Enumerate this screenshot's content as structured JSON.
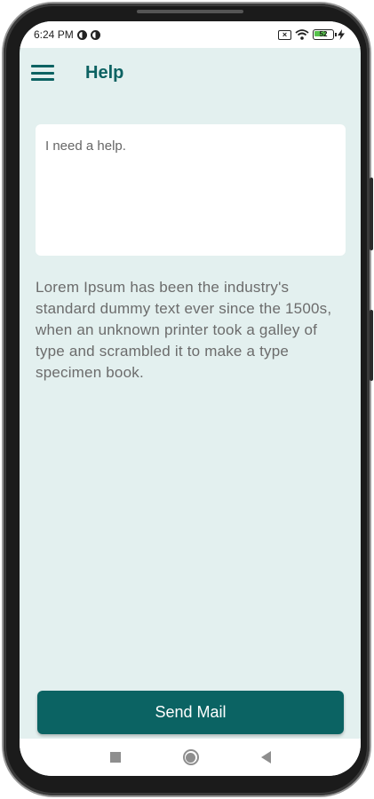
{
  "status_bar": {
    "time": "6:24 PM",
    "battery_level": "52"
  },
  "app_bar": {
    "title": "Help"
  },
  "message": {
    "placeholder": "I need a help."
  },
  "help": {
    "text": "Lorem Ipsum has been the industry's standard dummy text ever since the 1500s, when an unknown printer took a galley of type and scrambled it to make a type specimen book."
  },
  "actions": {
    "send_label": "Send Mail"
  },
  "icons": {
    "menu": "hamburger-menu-icon",
    "recents": "square-icon",
    "home": "circle-icon",
    "back": "triangle-back-icon"
  },
  "colors": {
    "primary": "#0b6363",
    "background": "#e3f0ef",
    "text_muted": "#6c6c6c"
  }
}
